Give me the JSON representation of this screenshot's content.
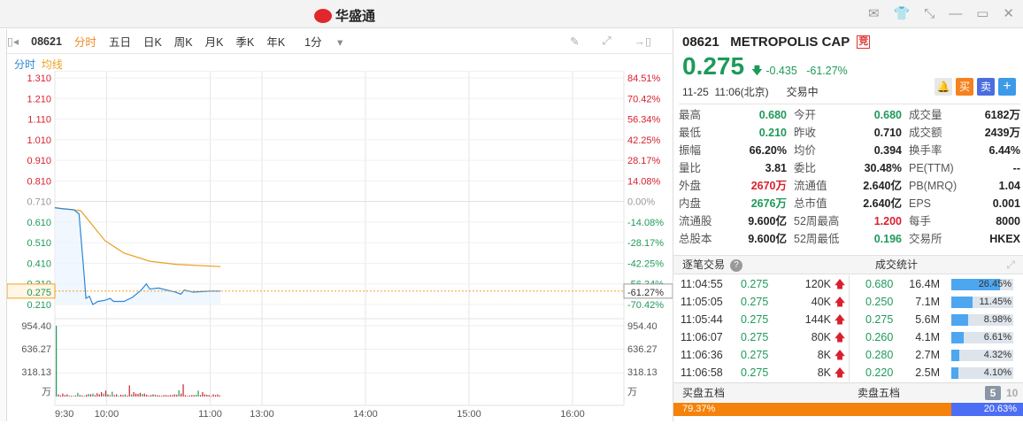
{
  "app": {
    "title": "华盛通"
  },
  "toolbar": {
    "code": "08621",
    "tabs": [
      "分时",
      "五日",
      "日K",
      "周K",
      "月K",
      "季K",
      "年K"
    ],
    "interval": "1分"
  },
  "subtabs": {
    "time": "分时",
    "avg": "均线"
  },
  "chart_data": {
    "type": "line",
    "price_ticks": [
      "1.310",
      "1.210",
      "1.110",
      "1.010",
      "0.910",
      "0.810",
      "0.710",
      "0.610",
      "0.510",
      "0.410",
      "0.310",
      "0.210"
    ],
    "pct_ticks": [
      "84.51%",
      "70.42%",
      "56.34%",
      "42.25%",
      "28.17%",
      "14.08%",
      "0.00%",
      "-14.08%",
      "-28.17%",
      "-42.25%",
      "-56.34%",
      "-70.42%"
    ],
    "prev_close": 0.71,
    "current_label": "0.275",
    "current_pct": "-61.27%",
    "vol_ticks": [
      "954.40",
      "636.27",
      "318.13",
      "万"
    ],
    "vol_max": 954.4,
    "time_labels": [
      "9:30",
      "10:00",
      "11:00",
      "13:00",
      "14:00",
      "15:00",
      "16:00"
    ],
    "price_series": [
      [
        0,
        0.68
      ],
      [
        4,
        0.675
      ],
      [
        11,
        0.67
      ],
      [
        14,
        0.65
      ],
      [
        15,
        0.55
      ],
      [
        17,
        0.35
      ],
      [
        18,
        0.24
      ],
      [
        20,
        0.25
      ],
      [
        22,
        0.21
      ],
      [
        25,
        0.225
      ],
      [
        29,
        0.23
      ],
      [
        32,
        0.24
      ],
      [
        34,
        0.225
      ],
      [
        40,
        0.225
      ],
      [
        45,
        0.245
      ],
      [
        50,
        0.28
      ],
      [
        53,
        0.31
      ],
      [
        55,
        0.285
      ],
      [
        60,
        0.29
      ],
      [
        70,
        0.27
      ],
      [
        73,
        0.26
      ],
      [
        75,
        0.28
      ],
      [
        80,
        0.27
      ],
      [
        90,
        0.275
      ],
      [
        96,
        0.275
      ]
    ],
    "avg_series": [
      [
        0,
        0.68
      ],
      [
        15,
        0.665
      ],
      [
        29,
        0.52
      ],
      [
        40,
        0.46
      ],
      [
        55,
        0.42
      ],
      [
        70,
        0.405
      ],
      [
        96,
        0.394
      ]
    ],
    "volume": [
      954,
      30,
      15,
      40,
      20,
      30,
      15,
      10,
      8,
      15,
      50,
      20,
      15,
      10,
      25,
      35,
      30,
      40,
      20,
      45,
      30,
      60,
      40,
      80,
      30,
      20,
      65,
      20,
      30,
      10,
      25,
      20,
      30,
      15,
      150,
      30,
      60,
      40,
      35,
      50,
      35,
      40,
      25,
      15,
      20,
      30,
      25,
      20,
      15,
      10,
      20,
      20,
      15,
      20,
      20,
      30,
      25,
      85,
      40,
      165,
      20,
      10,
      15,
      20,
      20,
      25,
      80,
      20,
      60,
      30,
      25,
      20,
      10,
      30,
      20,
      30,
      15
    ],
    "volume_up": [
      0,
      1,
      1,
      1,
      1,
      1,
      0,
      1,
      1,
      1,
      0,
      1,
      1,
      0,
      1,
      0,
      1,
      0,
      1,
      1,
      1,
      1,
      0,
      1,
      1,
      0,
      0,
      1,
      1,
      0,
      1,
      1,
      0,
      1,
      1,
      0,
      1,
      1,
      1,
      1,
      0,
      1,
      1,
      0,
      1,
      1,
      0,
      1,
      1,
      1,
      1,
      1,
      1,
      1,
      1,
      1,
      1,
      0,
      1,
      1,
      1,
      1,
      1,
      1,
      1,
      0,
      0,
      1,
      1,
      1,
      1,
      1,
      1,
      1,
      1,
      1,
      1
    ]
  },
  "quote": {
    "code": "08621",
    "name": "METROPOLIS CAP",
    "tag": "竞",
    "price": "0.275",
    "change": "-0.435",
    "pct": "-61.27%",
    "date": "11-25",
    "time": "11:06(北京)",
    "status": "交易中",
    "buy": "买",
    "sell": "卖",
    "add": "+"
  },
  "stats": [
    [
      "最高",
      "0.680",
      "今开",
      "0.680",
      "成交量",
      "6182万"
    ],
    [
      "最低",
      "0.210",
      "昨收",
      "0.710",
      "成交额",
      "2439万"
    ],
    [
      "振幅",
      "66.20%",
      "均价",
      "0.394",
      "换手率",
      "6.44%"
    ],
    [
      "量比",
      "3.81",
      "委比",
      "30.48%",
      "PE(TTM)",
      "--"
    ],
    [
      "外盘",
      "2670万",
      "流通值",
      "2.640亿",
      "PB(MRQ)",
      "1.04"
    ],
    [
      "内盘",
      "2676万",
      "总市值",
      "2.640亿",
      "EPS",
      "0.001"
    ],
    [
      "流通股",
      "9.600亿",
      "52周最高",
      "1.200",
      "每手",
      "8000"
    ],
    [
      "总股本",
      "9.600亿",
      "52周最低",
      "0.196",
      "交易所",
      "HKEX"
    ]
  ],
  "ticks_title": "逐笔交易",
  "stats_title": "成交统计",
  "trades": [
    {
      "time": "11:04:55",
      "price": "0.275",
      "vol": "120K"
    },
    {
      "time": "11:05:05",
      "price": "0.275",
      "vol": "40K"
    },
    {
      "time": "11:05:44",
      "price": "0.275",
      "vol": "144K"
    },
    {
      "time": "11:06:07",
      "price": "0.275",
      "vol": "80K"
    },
    {
      "time": "11:06:36",
      "price": "0.275",
      "vol": "8K"
    },
    {
      "time": "11:06:58",
      "price": "0.275",
      "vol": "8K"
    }
  ],
  "volstats": [
    {
      "price": "0.680",
      "vol": "16.4M",
      "pct": "26.45%",
      "f": 26.45
    },
    {
      "price": "0.250",
      "vol": "7.1M",
      "pct": "11.45%",
      "f": 11.45
    },
    {
      "price": "0.275",
      "vol": "5.6M",
      "pct": "8.98%",
      "f": 8.98
    },
    {
      "price": "0.260",
      "vol": "4.1M",
      "pct": "6.61%",
      "f": 6.61
    },
    {
      "price": "0.280",
      "vol": "2.7M",
      "pct": "4.32%",
      "f": 4.32
    },
    {
      "price": "0.220",
      "vol": "2.5M",
      "pct": "4.10%",
      "f": 4.1
    }
  ],
  "book": {
    "bid_title": "买盘五档",
    "ask_title": "卖盘五档",
    "five": "5",
    "ten": "10",
    "bid_pct": "79.37%",
    "ask_pct": "20.63%",
    "bid_frac": 79.37
  }
}
